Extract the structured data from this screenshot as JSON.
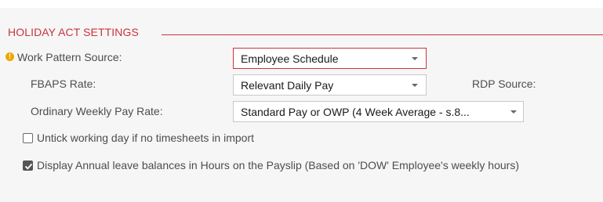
{
  "section": {
    "title": "HOLIDAY ACT SETTINGS",
    "accent_color": "#c9343e",
    "warning_color": "#f0a500"
  },
  "work_pattern": {
    "label": "Work Pattern Source:",
    "value": "Employee Schedule",
    "warning_icon_glyph": "!"
  },
  "fbaps": {
    "label": "FBAPS Rate:",
    "value": "Relevant Daily Pay"
  },
  "rdp": {
    "label": "RDP Source:"
  },
  "owp": {
    "label": "Ordinary Weekly Pay Rate:",
    "value": "Standard Pay or OWP (4 Week Average - s.8..."
  },
  "untick": {
    "label": "Untick working day if no timesheets in import",
    "checked": false
  },
  "display_hours": {
    "label": "Display Annual leave balances in Hours on the Payslip (Based on 'DOW' Employee's weekly hours)",
    "checked": true
  }
}
